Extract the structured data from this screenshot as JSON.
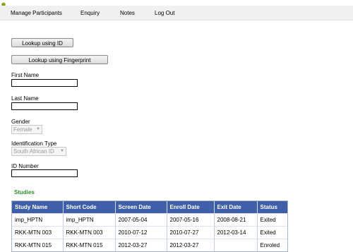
{
  "menu": [
    "Manage Participants",
    "Enquiry",
    "Notes",
    "Log Out"
  ],
  "buttons": {
    "lookup_id": "Lookup using ID",
    "lookup_fingerprint": "Lookup using Fingerprint"
  },
  "form": {
    "first_name_label": "First Name",
    "first_name_value": "",
    "last_name_label": "Last Name",
    "last_name_value": "",
    "gender_label": "Gender",
    "gender_value": "Female",
    "id_type_label": "Identification Type",
    "id_type_value": "South African ID",
    "id_number_label": "ID Number",
    "id_number_value": ""
  },
  "studies": {
    "title": "Studies",
    "columns": [
      "Study Name",
      "Short Code",
      "Screen Date",
      "Enroll Date",
      "Exit Date",
      "Status"
    ],
    "rows": [
      [
        "imp_HPTN",
        "imp_HPTN",
        "2007-05-04",
        "2007-05-16",
        "2008-08-21",
        "Exited"
      ],
      [
        "RKK-MTN 003",
        "RKK-MTN 003",
        "2010-07-12",
        "2010-07-27",
        "2012-03-14",
        "Exited"
      ],
      [
        "RKK-MTN 015",
        "RKK-MTN 015",
        "2012-03-27",
        "2012-03-27",
        "",
        "Enroled"
      ]
    ]
  },
  "colors": {
    "header_bg": "#3f5fa8",
    "studies_title": "#2e8b2e",
    "menubar_bg": "#f0f0f0"
  },
  "icons": {
    "app": "app-leaf-icon",
    "dropdown": "chevron-down-icon"
  }
}
